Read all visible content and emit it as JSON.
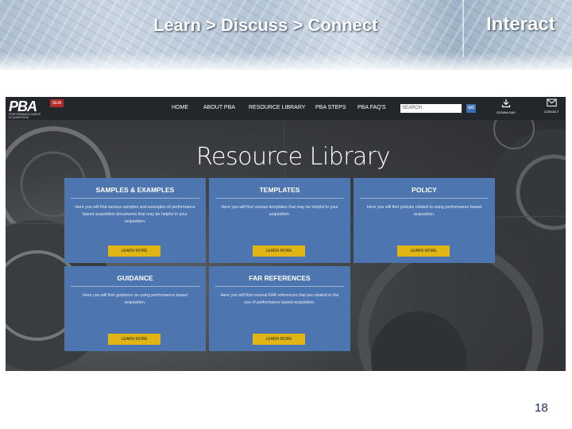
{
  "slide": {
    "header_left": "Learn > Discuss > Connect",
    "header_right": "Interact",
    "page_number": "18"
  },
  "site": {
    "logo": {
      "text": "PBA",
      "badge": "SEIA",
      "subtitle": "PERFORMANCE-BASED ACQUISITIONS"
    },
    "nav": [
      "HOME",
      "ABOUT PBA",
      "RESOURCE LIBRARY",
      "PBA STEPS",
      "PBA FAQ'S"
    ],
    "search": {
      "placeholder": "SEARCH",
      "button": "GO"
    },
    "tools": [
      {
        "label": "DOWNLOAD",
        "icon": "download-icon"
      },
      {
        "label": "CONTACT",
        "icon": "envelope-icon"
      }
    ],
    "page_title": "Resource Library",
    "cards": [
      {
        "title": "SAMPLES & EXAMPLES",
        "desc": "Here you will find various samples and examples of performance based acquisition documents that may be helpful in your acquisition.",
        "button": "LEARN MORE"
      },
      {
        "title": "TEMPLATES",
        "desc": "Here you will find various templates that may be helpful to your acquisition.",
        "button": "LEARN MORE"
      },
      {
        "title": "POLICY",
        "desc": "Here you will find policies related to using performance based acquisition.",
        "button": "LEARN MORE"
      },
      {
        "title": "GUIDANCE",
        "desc": "Here you will find guidance on using performance based acquisition.",
        "button": "LEARN MORE"
      },
      {
        "title": "FAR REFERENCES",
        "desc": "Here you will find several FAR references that are related to the use of performance based acquisition.",
        "button": "LEARN MORE"
      }
    ]
  },
  "colors": {
    "nav_bg": "#23272b",
    "card_bg": "#4d76b0",
    "button_bg": "#e1b514",
    "badge_red": "#b22b2b",
    "page_number": "#17305c"
  }
}
